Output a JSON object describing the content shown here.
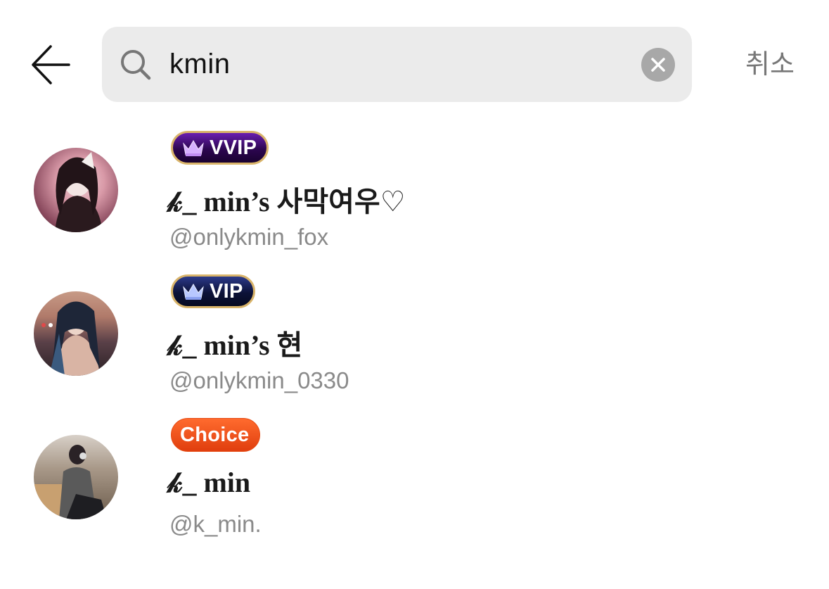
{
  "search": {
    "query": "kmin",
    "cancel_label": "취소"
  },
  "icons": {
    "back": "arrow-left-icon",
    "search": "search-icon",
    "clear": "clear-circle-icon",
    "crown": "crown-icon"
  },
  "colors": {
    "search_bg": "#ebebeb",
    "choice_badge": "#e8471a",
    "vvip_badge": "#3a0a6a",
    "vip_badge": "#0c1238",
    "handle_text": "#8a8a8a"
  },
  "results": [
    {
      "badge": "VVIP",
      "name": "𝓀_ min’s 사막여우♡",
      "handle": "@onlykmin_fox"
    },
    {
      "badge": "VIP",
      "name": "𝓀_ min’s 현",
      "handle": "@onlykmin_0330"
    },
    {
      "badge": "Choice",
      "name": "𝓀_ min",
      "handle": "@k_min."
    }
  ]
}
